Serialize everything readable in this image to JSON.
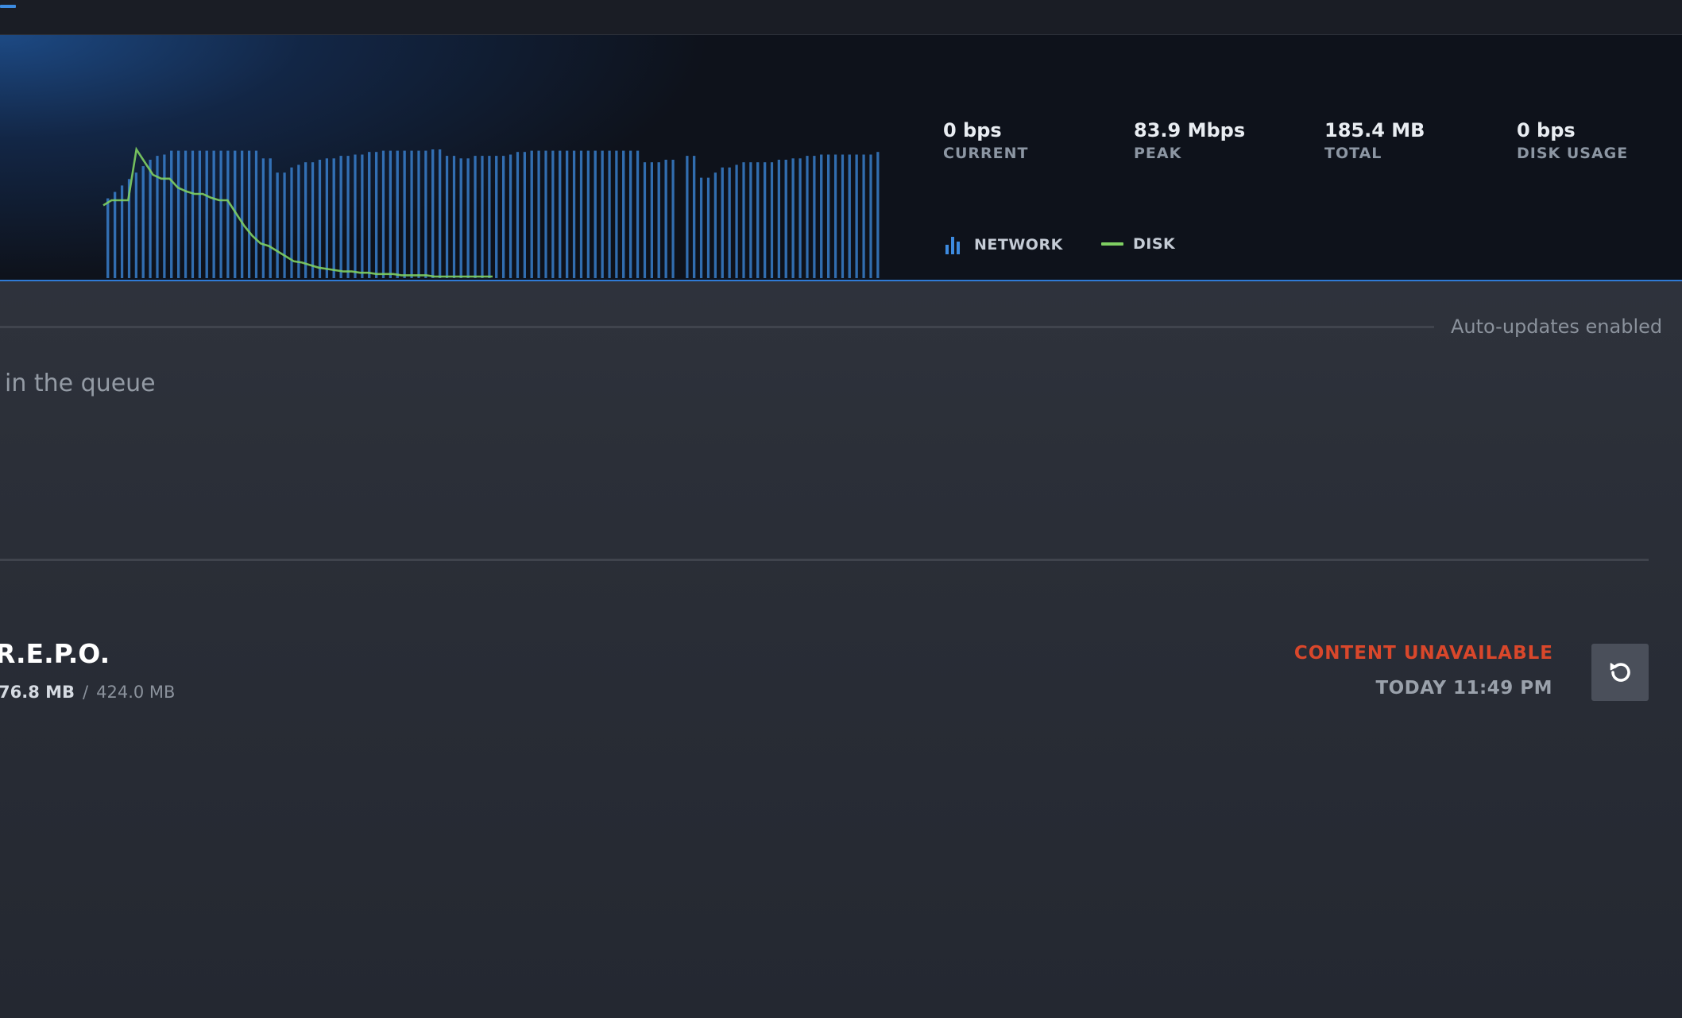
{
  "graph": {
    "stats": [
      {
        "value": "0 bps",
        "label": "CURRENT"
      },
      {
        "value": "83.9 Mbps",
        "label": "PEAK"
      },
      {
        "value": "185.4 MB",
        "label": "TOTAL"
      },
      {
        "value": "0 bps",
        "label": "DISK USAGE"
      }
    ],
    "legend": {
      "network_label": "NETWORK",
      "disk_label": "DISK"
    },
    "colors": {
      "network": "#3d8be0",
      "disk": "#7fcf62",
      "accent": "#2f7ad6"
    }
  },
  "chart_data": {
    "type": "bar",
    "series": [
      {
        "name": "NETWORK",
        "type": "bar",
        "values": [
          0.62,
          0.67,
          0.72,
          0.77,
          0.82,
          0.87,
          0.92,
          0.95,
          0.96,
          0.99,
          0.99,
          0.99,
          0.99,
          0.99,
          0.99,
          0.99,
          0.99,
          0.99,
          0.99,
          0.99,
          0.99,
          0.99,
          0.93,
          0.93,
          0.82,
          0.82,
          0.86,
          0.88,
          0.9,
          0.9,
          0.92,
          0.93,
          0.93,
          0.95,
          0.95,
          0.96,
          0.96,
          0.98,
          0.98,
          0.99,
          0.99,
          0.99,
          0.99,
          0.99,
          0.99,
          0.99,
          1.0,
          1.0,
          0.95,
          0.95,
          0.93,
          0.93,
          0.95,
          0.95,
          0.95,
          0.95,
          0.95,
          0.96,
          0.98,
          0.98,
          0.99,
          0.99,
          0.99,
          0.99,
          0.99,
          0.99,
          0.99,
          0.99,
          0.99,
          0.99,
          0.99,
          0.99,
          0.99,
          0.99,
          0.99,
          0.99,
          0.9,
          0.9,
          0.9,
          0.92,
          0.92,
          0.0,
          0.95,
          0.95,
          0.78,
          0.78,
          0.82,
          0.86,
          0.86,
          0.88,
          0.9,
          0.9,
          0.9,
          0.9,
          0.9,
          0.92,
          0.92,
          0.93,
          0.93,
          0.95,
          0.95,
          0.96,
          0.96,
          0.96,
          0.96,
          0.96,
          0.96,
          0.96,
          0.96,
          0.98
        ]
      },
      {
        "name": "DISK",
        "type": "line",
        "values": [
          0.56,
          0.6,
          0.6,
          0.6,
          1.0,
          0.9,
          0.8,
          0.77,
          0.77,
          0.7,
          0.67,
          0.65,
          0.65,
          0.62,
          0.6,
          0.6,
          0.5,
          0.4,
          0.32,
          0.26,
          0.24,
          0.2,
          0.16,
          0.12,
          0.11,
          0.09,
          0.07,
          0.06,
          0.05,
          0.04,
          0.04,
          0.03,
          0.03,
          0.02,
          0.02,
          0.02,
          0.01,
          0.01,
          0.01,
          0.01,
          0.0,
          0.0,
          0.0,
          0.0,
          0.0,
          0.0,
          0.0,
          0.0
        ]
      }
    ],
    "legend": "below-stats",
    "grid": false
  },
  "header": {
    "auto_updates": "Auto-updates enabled"
  },
  "queue": {
    "empty_text": "in the queue"
  },
  "download": {
    "name": "R.E.P.O.",
    "downloaded": "76.8 MB",
    "separator": "/",
    "total": "424.0 MB",
    "status": "CONTENT UNAVAILABLE",
    "time": "TODAY 11:49 PM",
    "retry_icon": "retry-icon",
    "status_color": "#d9472b"
  }
}
